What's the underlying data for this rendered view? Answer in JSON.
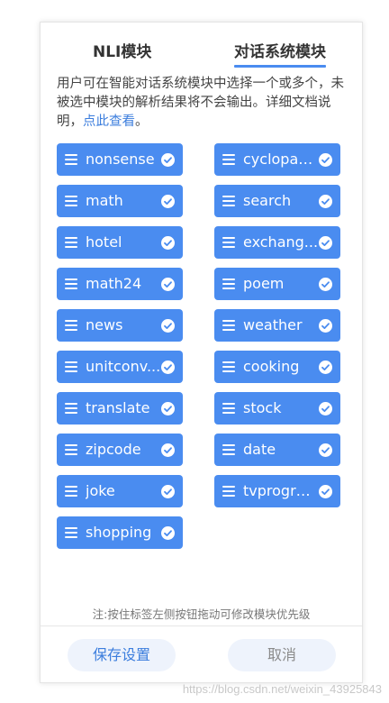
{
  "tabs": {
    "nli": "NLI模块",
    "dialog": "对话系统模块"
  },
  "description": {
    "text": "用户可在智能对话系统模块中选择一个或多个，未被选中模块的解析结果将不会输出。详细文档说明，",
    "link": "点此查看",
    "tail": "。"
  },
  "modules": [
    "nonsense",
    "cyclopae...",
    "math",
    "search",
    "hotel",
    "exchang...",
    "math24",
    "poem",
    "news",
    "weather",
    "unitconv...",
    "cooking",
    "translate",
    "stock",
    "zipcode",
    "date",
    "joke",
    "tvprogram",
    "shopping"
  ],
  "note": "注:按住标签左侧按钮拖动可修改模块优先级",
  "buttons": {
    "save": "保存设置",
    "cancel": "取消"
  },
  "watermark": "https://blog.csdn.net/weixin_43925843",
  "colors": {
    "chip": "#4a8cf0",
    "link": "#3b7ddd",
    "button_bg": "#eef3fc"
  }
}
